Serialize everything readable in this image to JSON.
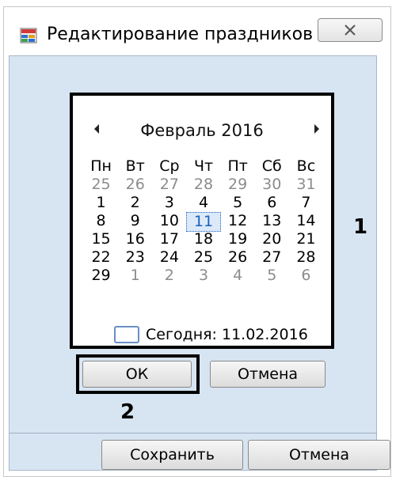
{
  "window": {
    "title": "Редактирование праздников",
    "icon": "calendar-app-icon",
    "close_icon": "close-icon"
  },
  "calendar": {
    "month_label": "Февраль 2016",
    "weekdays": [
      "Пн",
      "Вт",
      "Ср",
      "Чт",
      "Пт",
      "Сб",
      "Вс"
    ],
    "weeks": [
      [
        "25",
        "26",
        "27",
        "28",
        "29",
        "30",
        "31"
      ],
      [
        "1",
        "2",
        "3",
        "4",
        "5",
        "6",
        "7"
      ],
      [
        "8",
        "9",
        "10",
        "11",
        "12",
        "13",
        "14"
      ],
      [
        "15",
        "16",
        "17",
        "18",
        "19",
        "20",
        "21"
      ],
      [
        "22",
        "23",
        "24",
        "25",
        "26",
        "27",
        "28"
      ],
      [
        "29",
        "1",
        "2",
        "3",
        "4",
        "5",
        "6"
      ]
    ],
    "today_label": "Сегодня: 11.02.2016",
    "selected_day": "11"
  },
  "annotations": {
    "label_1": "1",
    "label_2": "2"
  },
  "buttons": {
    "ok": "ОК",
    "cancel_inner": "Отмена",
    "save": "Сохранить",
    "cancel_outer": "Отмена"
  },
  "colors": {
    "client_bg": "#d7e4f2",
    "muted_day": "#8c8c8c",
    "today_highlight": "#1f5fbf"
  }
}
